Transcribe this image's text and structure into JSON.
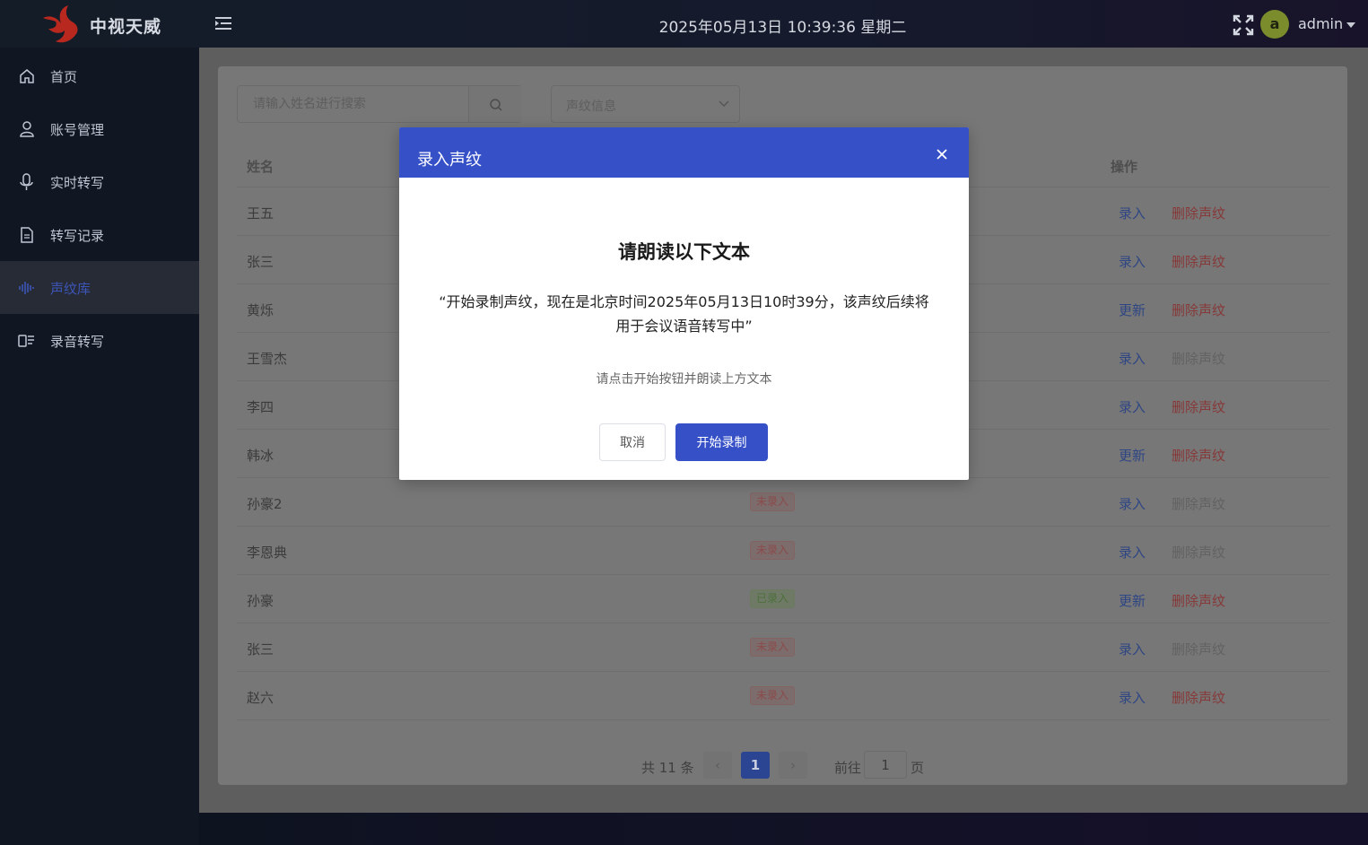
{
  "app": {
    "name": "中视天威",
    "datetime": "2025年05月13日 10:39:36 星期二",
    "user": {
      "initial": "a",
      "name": "admin"
    }
  },
  "sidebar": {
    "items": [
      {
        "label": "首页",
        "icon": "home-icon"
      },
      {
        "label": "账号管理",
        "icon": "user-icon"
      },
      {
        "label": "实时转写",
        "icon": "microphone-icon"
      },
      {
        "label": "转写记录",
        "icon": "document-icon"
      },
      {
        "label": "声纹库",
        "icon": "waveform-icon",
        "active": true
      },
      {
        "label": "录音转写",
        "icon": "recording-icon"
      }
    ]
  },
  "filters": {
    "search_placeholder": "请输入姓名进行搜索",
    "select_value": "声纹信息"
  },
  "table": {
    "headers": {
      "name": "姓名",
      "actions": "操作"
    },
    "rows": [
      {
        "name": "王五",
        "status": "",
        "action": "录入",
        "delete": "删除声纹",
        "delete_enabled": true
      },
      {
        "name": "张三",
        "status": "",
        "action": "录入",
        "delete": "删除声纹",
        "delete_enabled": true
      },
      {
        "name": "黄烁",
        "status": "",
        "action": "更新",
        "delete": "删除声纹",
        "delete_enabled": true
      },
      {
        "name": "王雪杰",
        "status": "",
        "action": "录入",
        "delete": "删除声纹",
        "delete_enabled": false
      },
      {
        "name": "李四",
        "status": "",
        "action": "录入",
        "delete": "删除声纹",
        "delete_enabled": true
      },
      {
        "name": "韩冰",
        "status": "",
        "action": "更新",
        "delete": "删除声纹",
        "delete_enabled": true
      },
      {
        "name": "孙豪2",
        "status": "未录入",
        "action": "录入",
        "delete": "删除声纹",
        "delete_enabled": false
      },
      {
        "name": "李恩典",
        "status": "未录入",
        "action": "录入",
        "delete": "删除声纹",
        "delete_enabled": false
      },
      {
        "name": "孙豪",
        "status": "已录入",
        "action": "更新",
        "delete": "删除声纹",
        "delete_enabled": true
      },
      {
        "name": "张三",
        "status": "未录入",
        "action": "录入",
        "delete": "删除声纹",
        "delete_enabled": false
      },
      {
        "name": "赵六",
        "status": "未录入",
        "action": "录入",
        "delete": "删除声纹",
        "delete_enabled": true
      }
    ]
  },
  "pagination": {
    "total": "共 11 条",
    "current": "1",
    "goto_label": "前往",
    "goto_value": "1",
    "page_suffix": "页"
  },
  "modal": {
    "title": "录入声纹",
    "heading": "请朗读以下文本",
    "text": "“开始录制声纹，现在是北京时间2025年05月13日10时39分，该声纹后续将用于会议语音转写中”",
    "hint": "请点击开始按钮并朗读上方文本",
    "cancel": "取消",
    "start": "开始录制"
  },
  "colors": {
    "primary": "#3650c8",
    "danger": "#873838",
    "sidebar_bg": "#111722"
  }
}
